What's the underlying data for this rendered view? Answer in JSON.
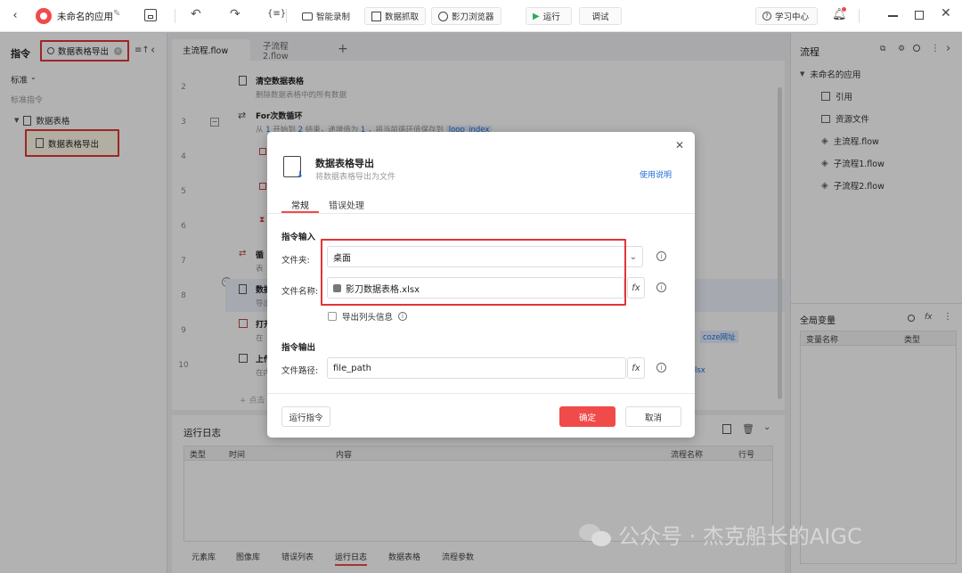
{
  "topbar": {
    "app_name": "未命名的应用",
    "buttons": {
      "record": "智能录制",
      "data_capture": "数据抓取",
      "browser": "影刀浏览器",
      "run": "运行",
      "debug": "调试",
      "learning": "学习中心"
    },
    "colors": {
      "accent_red": "#f04a4a",
      "run_green": "#2eaa5c",
      "link_blue": "#1e6fd9"
    }
  },
  "left": {
    "title": "指令",
    "search_value": "数据表格导出",
    "filter": "标准",
    "section": "标准指令",
    "tree_parent": "数据表格",
    "tree_item": "数据表格导出"
  },
  "tabs": [
    {
      "label": "主流程.flow"
    },
    {
      "label": "子流程2.flow"
    }
  ],
  "editor": {
    "line_numbers": [
      "2",
      "3",
      "4",
      "5",
      "6",
      "7",
      "8",
      "9",
      "10"
    ],
    "step_clear_title": "清空数据表格",
    "step_clear_desc": "删除数据表格中的所有数据",
    "step_for_title": "For次数循环",
    "step_for_desc_a": "从",
    "step_for_n1": "1",
    "step_for_desc_b": "开始到",
    "step_for_n2": "2",
    "step_for_desc_c": "结束，递增值为",
    "step_for_n3": "1",
    "step_for_desc_d": "，将当前循环值保存到",
    "step_for_var": "loop_index",
    "step7_title": "循",
    "step7_desc": "表",
    "step8_title": "数据",
    "step8_desc": "导出",
    "step9_title": "打开",
    "step9_desc": "在",
    "step9_tag": "coze网址",
    "step10_title": "上传",
    "step10_desc": "在内",
    "step10_tail": "lsx",
    "add_hint": "点击"
  },
  "log": {
    "title": "运行日志",
    "columns": [
      "类型",
      "时间",
      "内容",
      "流程名称",
      "行号"
    ],
    "bottom_tabs": [
      "元素库",
      "图像库",
      "错误列表",
      "运行日志",
      "数据表格",
      "流程参数"
    ]
  },
  "right": {
    "title": "流程",
    "tree_root": "未命名的应用",
    "tree_items": [
      "引用",
      "资源文件",
      "主流程.flow",
      "子流程1.flow",
      "子流程2.flow"
    ],
    "globals_title": "全局变量",
    "globals_columns": [
      "变量名称",
      "类型"
    ]
  },
  "dialog": {
    "title": "数据表格导出",
    "subtitle": "将数据表格导出为文件",
    "help_link": "使用说明",
    "tab_general": "常规",
    "tab_error": "错误处理",
    "section_input": "指令输入",
    "label_folder": "文件夹:",
    "folder_value": "桌面",
    "label_filename": "文件名称:",
    "filename_value": "影刀数据表格.xlsx",
    "checkbox_header": "导出列头信息",
    "section_output": "指令输出",
    "label_filepath": "文件路径:",
    "filepath_value": "file_path",
    "run_command": "运行指令",
    "confirm": "确定",
    "cancel": "取消"
  },
  "watermark": "公众号 · 杰克船长的AIGC"
}
